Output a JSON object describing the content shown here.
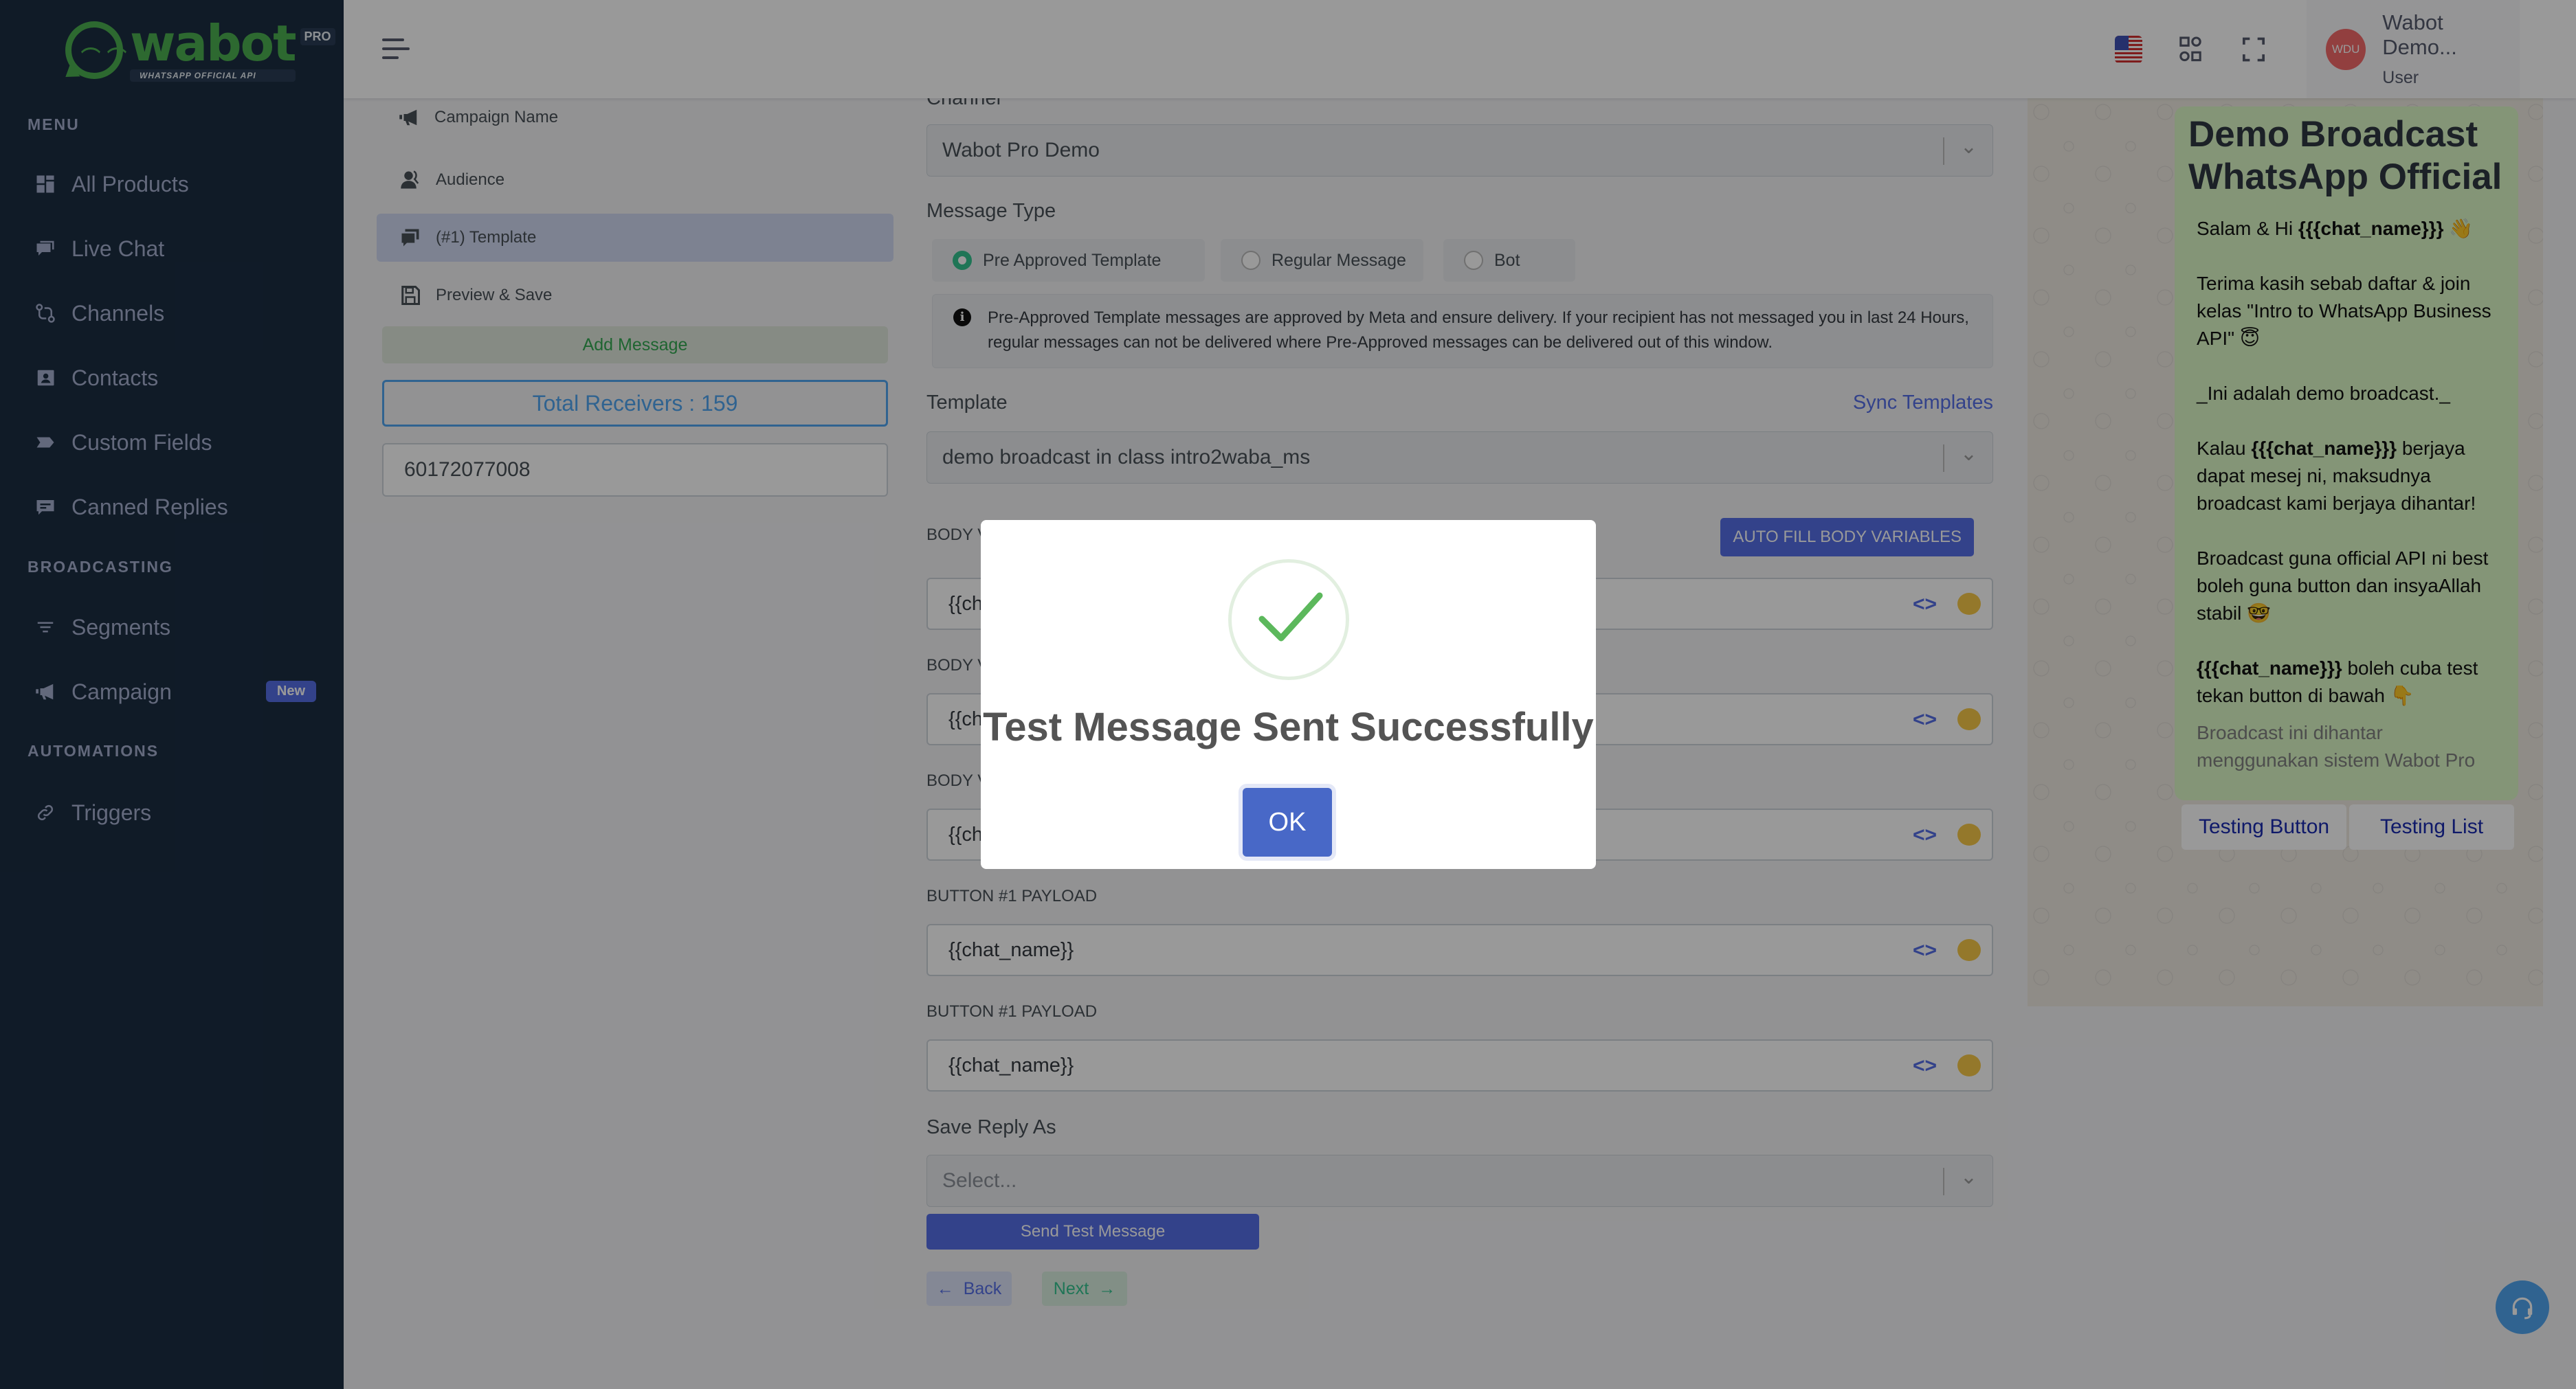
{
  "brand": {
    "logo_word": "wabot",
    "logo_badge": "PRO",
    "logo_tagline": "WHATSAPP OFFICIAL API"
  },
  "sidebar": {
    "sections": [
      {
        "title": "MENU"
      },
      {
        "title": "BROADCASTING"
      },
      {
        "title": "AUTOMATIONS"
      }
    ],
    "items": [
      {
        "label": "All Products",
        "icon": "grid-icon"
      },
      {
        "label": "Live Chat",
        "icon": "chat-icon"
      },
      {
        "label": "Channels",
        "icon": "channels-icon"
      },
      {
        "label": "Contacts",
        "icon": "contact-card-icon"
      },
      {
        "label": "Custom Fields",
        "icon": "tag-icon"
      },
      {
        "label": "Canned Replies",
        "icon": "message-icon"
      },
      {
        "label": "Segments",
        "icon": "filter-icon"
      },
      {
        "label": "Campaign",
        "icon": "megaphone-icon",
        "badge": "New"
      },
      {
        "label": "Triggers",
        "icon": "link-icon"
      }
    ]
  },
  "header": {
    "user_name": "Wabot Demo...",
    "user_role": "User",
    "avatar_initials": "WDU"
  },
  "steps": [
    {
      "label": "Campaign Name",
      "icon": "megaphone-icon"
    },
    {
      "label": "Audience",
      "icon": "users-icon"
    },
    {
      "label": "(#1) Template",
      "icon": "chat-icon",
      "active": true
    },
    {
      "label": "Preview & Save",
      "icon": "save-icon"
    }
  ],
  "left_panel": {
    "add_message": "Add Message",
    "total_receivers": "Total Receivers : 159",
    "test_phone": "60172077008"
  },
  "form": {
    "channel_label": "Channel",
    "channel_value": "Wabot Pro Demo",
    "message_type_label": "Message Type",
    "message_types": [
      {
        "label": "Pre Approved Template",
        "selected": true
      },
      {
        "label": "Regular Message",
        "selected": false
      },
      {
        "label": "Bot",
        "selected": false
      }
    ],
    "info_text": "Pre-Approved Template messages are approved by Meta and ensure delivery. If your recipient has not messaged you in last 24 Hours, regular messages can not be delivered where Pre-Approved messages can be delivered out of this window.",
    "template_label": "Template",
    "sync_templates": "Sync Templates",
    "template_value": "demo broadcast in class intro2waba_ms",
    "auto_fill": "AUTO FILL BODY VARIABLES",
    "fields": [
      {
        "label": "BODY V",
        "value": "{{ch"
      },
      {
        "label": "BODY V",
        "value": "{{ch"
      },
      {
        "label": "BODY V",
        "value": "{{ch"
      },
      {
        "label": "BUTTON #1 PAYLOAD",
        "value": "{{chat_name}}"
      },
      {
        "label": "BUTTON #1 PAYLOAD",
        "value": "{{chat_name}}"
      }
    ],
    "code_icon_glyph": "<>",
    "save_reply_label": "Save Reply As",
    "save_reply_placeholder": "Select...",
    "send_test": "Send Test Message",
    "back": "Back",
    "next": "Next"
  },
  "preview": {
    "title": "Demo Broadcast WhatsApp Official",
    "body": [
      {
        "parts": [
          {
            "t": "Salam & Hi "
          },
          {
            "t": "{{{chat_name}}}",
            "b": true
          },
          {
            "t": " 👋"
          }
        ]
      },
      {
        "parts": [
          {
            "t": "Terima kasih sebab daftar & join kelas \"Intro to WhatsApp Business API\" 😇"
          }
        ]
      },
      {
        "parts": [
          {
            "t": "_Ini adalah demo broadcast._"
          }
        ]
      },
      {
        "parts": [
          {
            "t": "Kalau "
          },
          {
            "t": "{{{chat_name}}}",
            "b": true
          },
          {
            "t": " berjaya dapat mesej ni, maksudnya broadcast kami berjaya dihantar!"
          }
        ]
      },
      {
        "parts": [
          {
            "t": "Broadcast guna official API ni best boleh guna button dan insyaAllah stabil 🤓"
          }
        ]
      },
      {
        "parts": [
          {
            "t": "{{{chat_name}}}",
            "b": true
          },
          {
            "t": " boleh cuba test tekan button di bawah 👇"
          }
        ]
      }
    ],
    "footer": "Broadcast ini dihantar menggunakan sistem Wabot Pro",
    "buttons": [
      "Testing Button",
      "Testing List"
    ]
  },
  "modal": {
    "title": "Test Message Sent Successfully",
    "ok": "OK",
    "success_color": "#5cb85c"
  },
  "colors": {
    "primary": "#556ee6",
    "success": "#34c38f",
    "sidebar_bg": "#1b2d42"
  }
}
